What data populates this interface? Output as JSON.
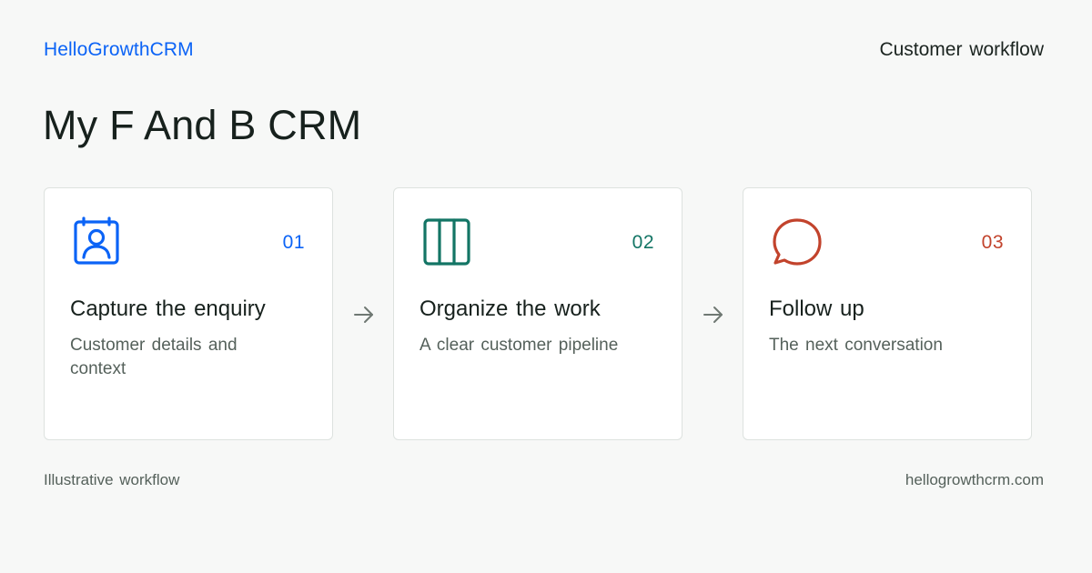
{
  "header": {
    "brand": "HelloGrowthCRM",
    "tagline": "Customer workflow"
  },
  "page_title": "My F And B CRM",
  "colors": {
    "brand": "#0b63f6",
    "step1": "#0b63f6",
    "step2": "#137565",
    "step3": "#c2432c",
    "arrow": "#6f7873"
  },
  "steps": [
    {
      "number": "01",
      "title": "Capture the enquiry",
      "description": "Customer details and context",
      "icon": "contact-card-icon"
    },
    {
      "number": "02",
      "title": "Organize the work",
      "description": "A clear customer pipeline",
      "icon": "pipeline-columns-icon"
    },
    {
      "number": "03",
      "title": "Follow up",
      "description": "The next conversation",
      "icon": "chat-bubble-icon"
    }
  ],
  "footer": {
    "note": "Illustrative workflow",
    "website": "hellogrowthcrm.com"
  }
}
